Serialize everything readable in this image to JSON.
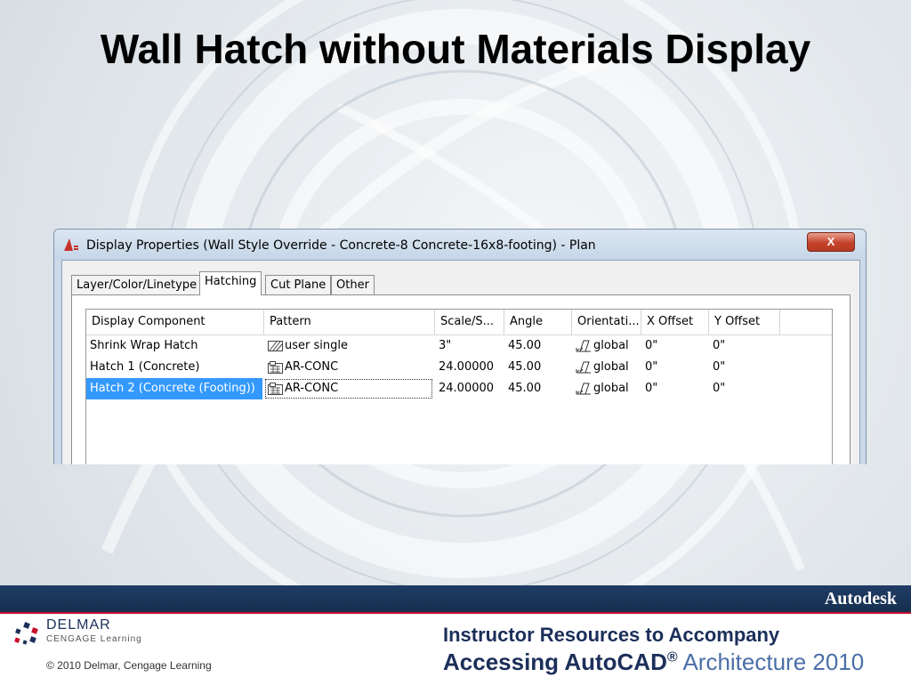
{
  "slide": {
    "title": "Wall Hatch without Materials Display"
  },
  "dialog": {
    "title": "Display Properties (Wall Style Override - Concrete-8 Concrete-16x8-footing) - Plan",
    "close_label": "X",
    "tabs": [
      {
        "label": "Layer/Color/Linetype",
        "active": false
      },
      {
        "label": "Hatching",
        "active": true
      },
      {
        "label": "Cut Plane",
        "active": false
      },
      {
        "label": "Other",
        "active": false
      }
    ],
    "columns": [
      "Display Component",
      "Pattern",
      "Scale/S...",
      "Angle",
      "Orientati...",
      "X Offset",
      "Y Offset"
    ],
    "rows": [
      {
        "component": "Shrink Wrap Hatch",
        "pattern": "user single",
        "pattern_icon": "hatch-user-single-icon",
        "scale": "3\"",
        "angle": "45.00",
        "orientation": "global",
        "x_offset": "0\"",
        "y_offset": "0\"",
        "selected": false
      },
      {
        "component": "Hatch 1 (Concrete)",
        "pattern": "AR-CONC",
        "pattern_icon": "hatch-ar-conc-icon",
        "scale": "24.00000",
        "angle": "45.00",
        "orientation": "global",
        "x_offset": "0\"",
        "y_offset": "0\"",
        "selected": false
      },
      {
        "component": "Hatch 2 (Concrete (Footing))",
        "pattern": "AR-CONC",
        "pattern_icon": "hatch-ar-conc-icon",
        "scale": "24.00000",
        "angle": "45.00",
        "orientation": "global",
        "x_offset": "0\"",
        "y_offset": "0\"",
        "selected": true
      }
    ]
  },
  "footer": {
    "brand": "Autodesk",
    "publisher": "DELMAR",
    "publisher_sub": "CENGAGE Learning",
    "copyright": "© 2010 Delmar, Cengage Learning",
    "line1": "Instructor Resources to Accompany",
    "product_bold": "Accessing AutoCAD",
    "product_reg": "®",
    "product_light": " Architecture 2010"
  },
  "colors": {
    "selection": "#3399ff",
    "footer_blue": "#1f3c66",
    "footer_accent": "#c8102e",
    "text_navy": "#1c2f5a"
  }
}
